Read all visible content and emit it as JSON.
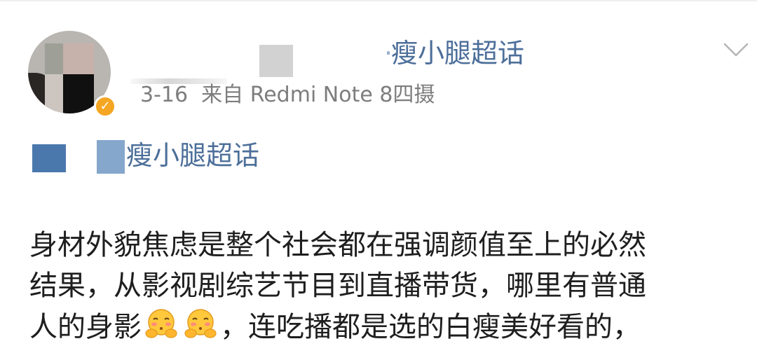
{
  "post": {
    "author": {
      "topic_name": "瘦小腿超话",
      "topic_name_prefix_fragment": "·"
    },
    "meta": {
      "date": "3-16",
      "source_label": "来自",
      "device": "Redmi Note 8四摄"
    },
    "topic_link": {
      "text": "瘦小腿超话"
    },
    "body": {
      "line1": "身材外貌焦虑是整个社会都在强调颜值至上的必然",
      "line2": "结果，从影视剧综艺节目到直播带货，哪里有普通",
      "line3_before_emoji": "人的身影",
      "line3_after_emoji": "，连吃播都是选的白瘦美好看的，"
    },
    "icons": {
      "menu": "chevron-down-icon",
      "verified": "verified-badge-icon",
      "emoji": "blush-hands-emoji-icon"
    },
    "colors": {
      "link": "#4d6f9a",
      "meta": "#7d7d7d",
      "text": "#1e1e1e",
      "badge": "#f5a623"
    }
  }
}
